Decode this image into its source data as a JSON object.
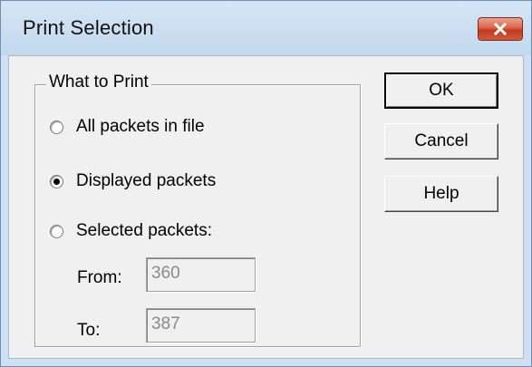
{
  "window": {
    "title": "Print Selection"
  },
  "group": {
    "label": "What to Print"
  },
  "options": [
    {
      "label": "All packets in file",
      "checked": false
    },
    {
      "label": "Displayed packets",
      "checked": true
    },
    {
      "label": "Selected packets:",
      "checked": false
    }
  ],
  "range": {
    "from_label": "From:",
    "from_value": "360",
    "to_label": "To:",
    "to_value": "387"
  },
  "buttons": {
    "ok": "OK",
    "cancel": "Cancel",
    "help": "Help"
  },
  "icons": {
    "close": "close-icon"
  }
}
